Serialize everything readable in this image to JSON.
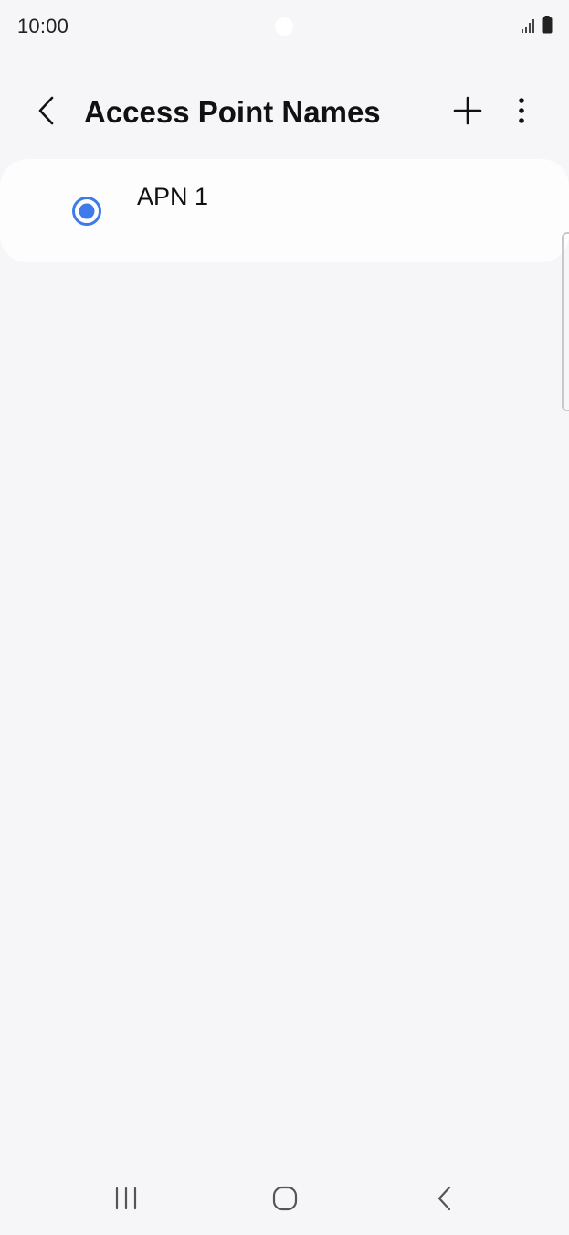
{
  "status_bar": {
    "time": "10:00",
    "icons": [
      "signal-icon",
      "battery-icon"
    ]
  },
  "header": {
    "title": "Access Point Names",
    "back_icon": "chevron-left-icon",
    "add_icon": "plus-icon",
    "more_icon": "more-vertical-icon"
  },
  "apn_list": {
    "items": [
      {
        "name": "APN 1",
        "selected": true
      }
    ]
  },
  "nav_bar": {
    "buttons": [
      "recents-icon",
      "home-icon",
      "back-icon"
    ]
  },
  "colors": {
    "background": "#f6f6f8",
    "card": "#fdfdfe",
    "accent": "#3e7bea",
    "text": "#111111"
  }
}
